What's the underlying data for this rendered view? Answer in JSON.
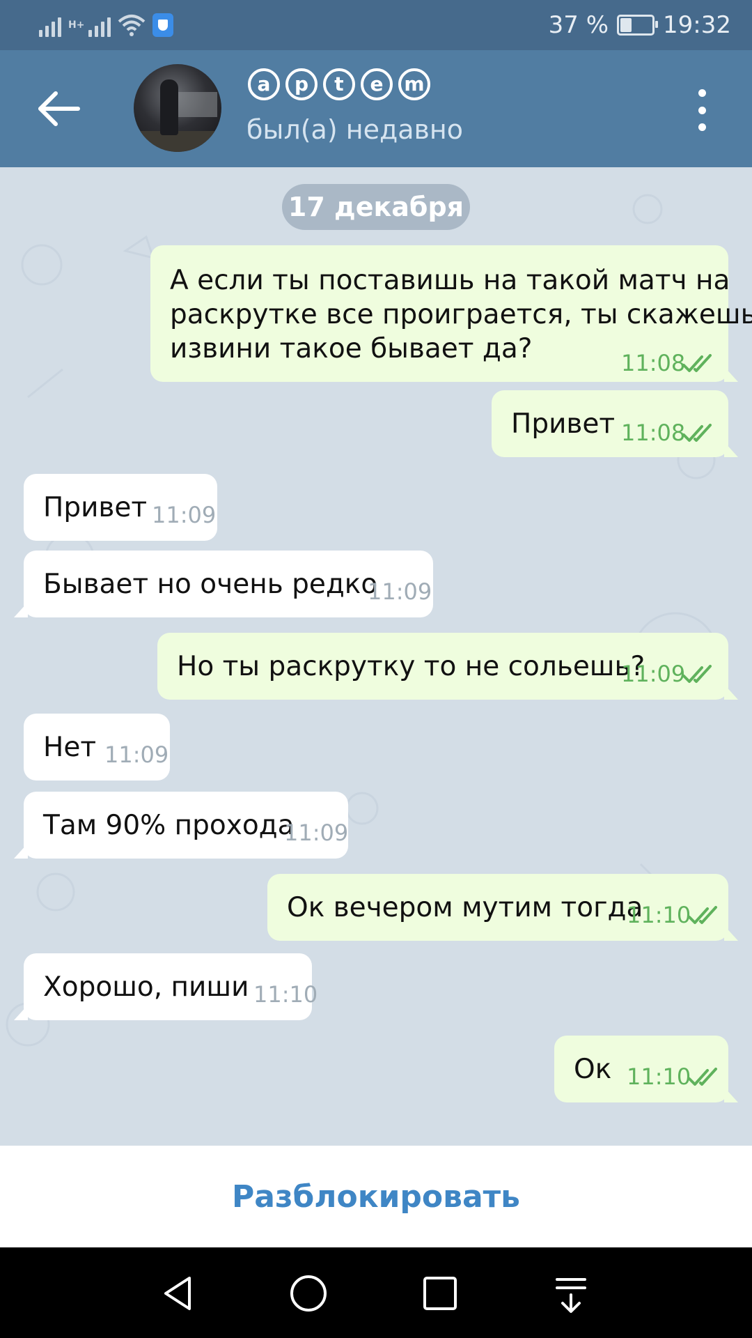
{
  "status_bar": {
    "network_label": "H+",
    "battery_level": 0.37,
    "battery": "37 %",
    "time": "19:32",
    "icons": [
      "signal-icon",
      "signal-icon",
      "wifi-icon",
      "shield-icon",
      "battery-icon"
    ]
  },
  "header": {
    "name": "ⓐⓟⓣⓔⓜ",
    "name_letters": [
      "a",
      "p",
      "t",
      "e",
      "m"
    ],
    "status": "был(а) недавно"
  },
  "chat": {
    "date": "17 декабря",
    "messages": [
      {
        "dir": "out",
        "lines": [
          "А если ты поставишь на такой матч на",
          "раскрутке все проиграется, ты скажешь",
          "извини такое бывает да?"
        ],
        "time": "11:08"
      },
      {
        "dir": "out",
        "lines": [
          "Привет"
        ],
        "time": "11:08"
      },
      {
        "dir": "in",
        "lines": [
          "Привет"
        ],
        "time": "11:09"
      },
      {
        "dir": "in",
        "lines": [
          "Бывает но очень редко"
        ],
        "time": "11:09"
      },
      {
        "dir": "out",
        "lines": [
          "Но ты раскрутку то не сольешь?"
        ],
        "time": "11:09"
      },
      {
        "dir": "in",
        "lines": [
          "Нет"
        ],
        "time": "11:09"
      },
      {
        "dir": "in",
        "lines": [
          "Там 90% прохода"
        ],
        "time": "11:09"
      },
      {
        "dir": "out",
        "lines": [
          "Ок вечером мутим тогда"
        ],
        "time": "11:10"
      },
      {
        "dir": "in",
        "lines": [
          "Хорошо, пиши"
        ],
        "time": "11:10"
      },
      {
        "dir": "out",
        "lines": [
          "Ок"
        ],
        "time": "11:10"
      }
    ]
  },
  "footer": {
    "unblock_label": "Разблокировать"
  },
  "colors": {
    "header": "#517da2",
    "status_bar": "#466a8c",
    "outgoing_bubble": "#effdde",
    "incoming_bubble": "#ffffff",
    "accent": "#3f86c5",
    "chat_background": "#d3dde6"
  },
  "nav": [
    "back-triangle-icon",
    "home-circle-icon",
    "recents-square-icon",
    "notifications-pulldown-icon"
  ]
}
